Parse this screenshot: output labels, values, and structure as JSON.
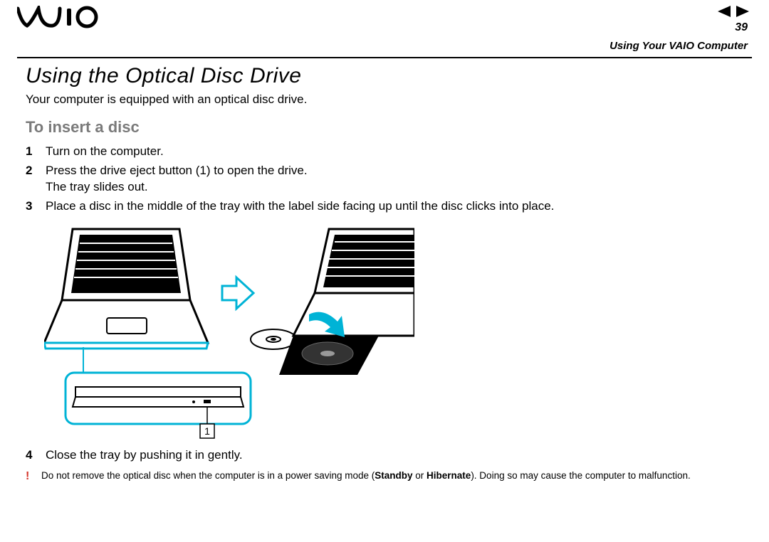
{
  "header": {
    "page_number": "39",
    "breadcrumb": "Using Your VAIO Computer"
  },
  "main": {
    "title": "Using the Optical Disc Drive",
    "intro": "Your computer is equipped with an optical disc drive.",
    "subhead": "To insert a disc",
    "steps": [
      {
        "n": "1",
        "text": "Turn on the computer."
      },
      {
        "n": "2",
        "text": "Press the drive eject button (1) to open the drive.\nThe tray slides out."
      },
      {
        "n": "3",
        "text": "Place a disc in the middle of the tray with the label side facing up until the disc clicks into place."
      }
    ],
    "steps_after": [
      {
        "n": "4",
        "text": "Close the tray by pushing it in gently."
      }
    ],
    "warning": {
      "mark": "!",
      "pre": "Do not remove the optical disc when the computer is in a power saving mode (",
      "b1": "Standby",
      "mid": " or ",
      "b2": "Hibernate",
      "post": "). Doing so may cause the computer to malfunction."
    },
    "callout_label": "1"
  }
}
